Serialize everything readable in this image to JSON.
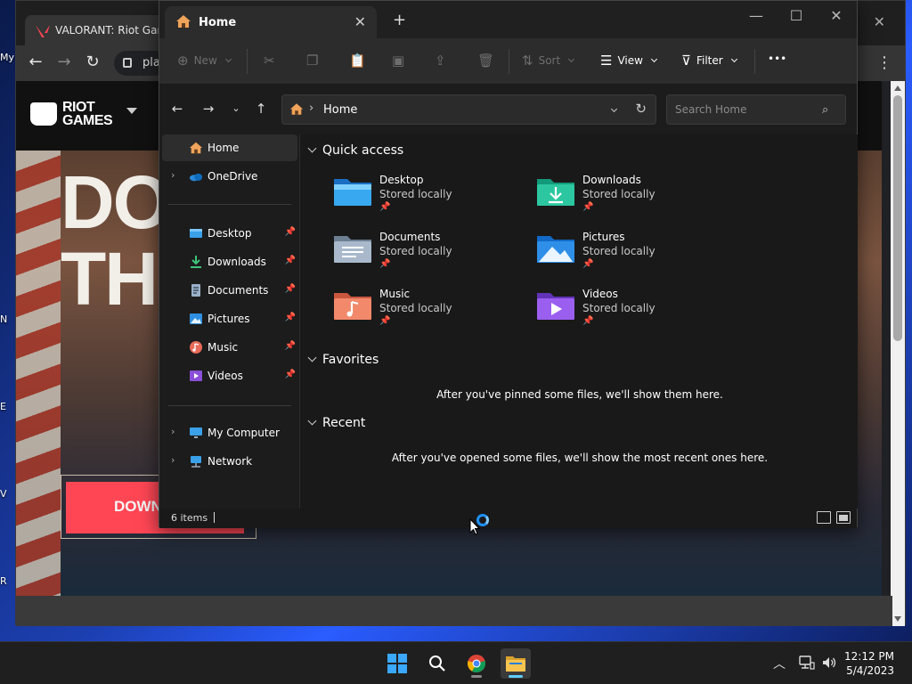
{
  "desktop": {
    "fragments": [
      "My",
      "N",
      "E",
      "V",
      "R"
    ]
  },
  "browser": {
    "tab_title": "VALORANT: Riot Games",
    "omnibox_text": "pla",
    "riot": {
      "logo_line1": "RIOT",
      "logo_line2": "GAMES",
      "hero_line1": "DOW",
      "hero_line2": "THE",
      "download_label": "DOWN"
    }
  },
  "explorer": {
    "tab_label": "Home",
    "toolbar": {
      "new_label": "New",
      "sort_label": "Sort",
      "view_label": "View",
      "filter_label": "Filter",
      "more_label": "•••"
    },
    "address": {
      "location": "Home",
      "search_placeholder": "Search Home"
    },
    "nav": {
      "home": "Home",
      "onedrive": "OneDrive",
      "pinned": [
        {
          "label": "Desktop",
          "icon": "desktop-icon"
        },
        {
          "label": "Downloads",
          "icon": "downloads-icon"
        },
        {
          "label": "Documents",
          "icon": "documents-icon"
        },
        {
          "label": "Pictures",
          "icon": "pictures-icon"
        },
        {
          "label": "Music",
          "icon": "music-icon"
        },
        {
          "label": "Videos",
          "icon": "videos-icon"
        }
      ],
      "my_computer": "My Computer",
      "network": "Network"
    },
    "sections": {
      "quick_access": "Quick access",
      "favorites": "Favorites",
      "recent": "Recent"
    },
    "quick_access_items": [
      {
        "name": "Desktop",
        "status": "Stored locally",
        "icon": "desktop-folder-icon"
      },
      {
        "name": "Downloads",
        "status": "Stored locally",
        "icon": "downloads-folder-icon"
      },
      {
        "name": "Documents",
        "status": "Stored locally",
        "icon": "documents-folder-icon"
      },
      {
        "name": "Pictures",
        "status": "Stored locally",
        "icon": "pictures-folder-icon"
      },
      {
        "name": "Music",
        "status": "Stored locally",
        "icon": "music-folder-icon"
      },
      {
        "name": "Videos",
        "status": "Stored locally",
        "icon": "videos-folder-icon"
      }
    ],
    "favorites_empty": "After you've pinned some files, we'll show them here.",
    "recent_empty": "After you've opened some files, we'll show the most recent ones here.",
    "status_items": "6 items"
  },
  "taskbar": {
    "time": "12:12 PM",
    "date": "5/4/2023"
  },
  "colors": {
    "explorer_bg": "#191919",
    "riot_red": "#ff4655",
    "accent_blue": "#60cdff",
    "folder_yellow": "#f7c44f"
  }
}
